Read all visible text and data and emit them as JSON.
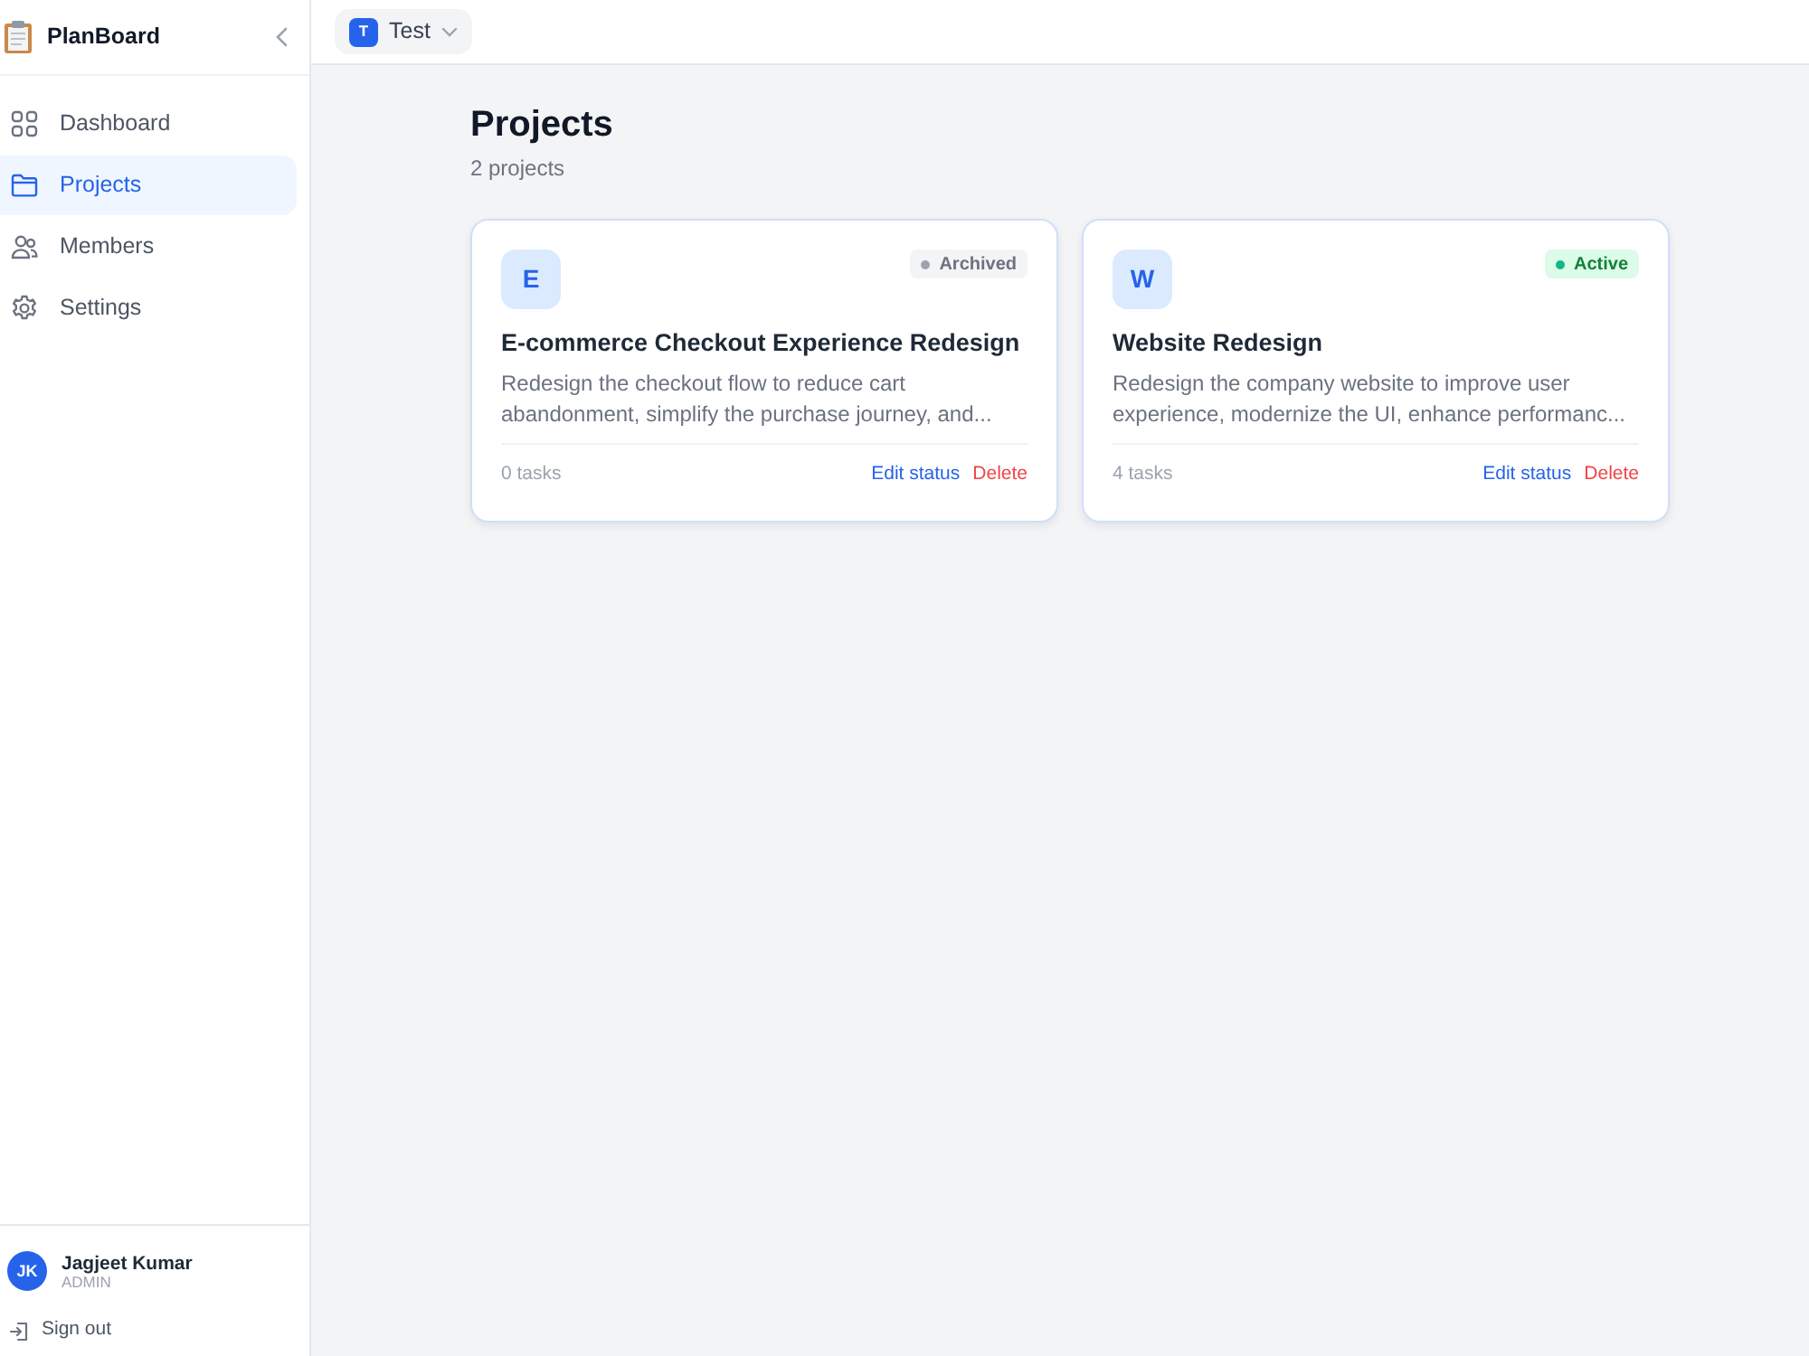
{
  "sidebar": {
    "brand": "PlanBoard",
    "items": [
      {
        "label": "Dashboard",
        "selected": false
      },
      {
        "label": "Projects",
        "selected": true
      },
      {
        "label": "Members",
        "selected": false
      },
      {
        "label": "Settings",
        "selected": false
      }
    ],
    "user": {
      "initials": "JK",
      "name": "Jagjeet Kumar",
      "role": "ADMIN"
    },
    "sign_out": "Sign out"
  },
  "topbar": {
    "workspace": {
      "initial": "T",
      "name": "Test"
    }
  },
  "page": {
    "title": "Projects",
    "subtitle": "2 projects"
  },
  "projects": [
    {
      "initial": "E",
      "status": {
        "label": "Archived",
        "kind": "archived",
        "color": "#9ca3af"
      },
      "title": "E-commerce Checkout Experience Redesign",
      "description": "Redesign the checkout flow to reduce cart abandonment, simplify the purchase journey, and...",
      "tasks": "0 tasks",
      "actions": [
        {
          "label": "Edit status",
          "kind": "edit"
        },
        {
          "label": "Delete",
          "kind": "danger"
        }
      ]
    },
    {
      "initial": "W",
      "status": {
        "label": "Active",
        "kind": "active",
        "color": "#10b981"
      },
      "title": "Website Redesign",
      "description": "Redesign the company website to improve user experience, modernize the UI, enhance performanc...",
      "tasks": "4 tasks",
      "actions": [
        {
          "label": "Edit status",
          "kind": "edit"
        },
        {
          "label": "Delete",
          "kind": "danger"
        }
      ]
    }
  ]
}
